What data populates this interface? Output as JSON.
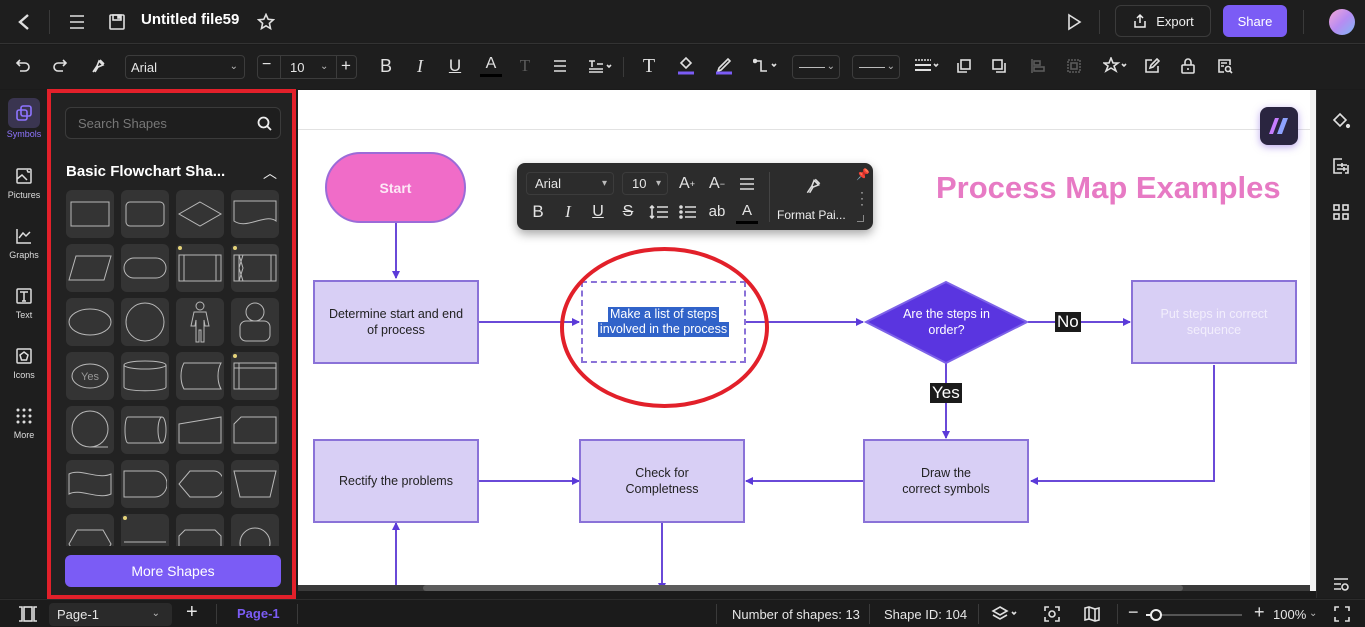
{
  "header": {
    "file_title": "Untitled file59",
    "export_label": "Export",
    "share_label": "Share",
    "icons": [
      "back-icon",
      "menu-icon",
      "save-icon",
      "star-icon",
      "play-icon",
      "export-icon",
      "avatar"
    ]
  },
  "toolbar": {
    "font_family": "Arial",
    "font_size": "10",
    "icons": [
      "undo-icon",
      "redo-icon",
      "format-painter-icon",
      "bold-icon",
      "italic-icon",
      "underline-icon",
      "font-color-icon",
      "text-style-icon",
      "align-icon",
      "text-spacing-icon",
      "text-tool-icon",
      "fill-color-icon",
      "line-color-icon",
      "connector-icon",
      "line-style-dropdown",
      "line-weight-dropdown",
      "line-dash-icon",
      "bring-front-icon",
      "send-back-icon",
      "align-shapes-icon",
      "group-icon",
      "magic-icon",
      "edit-icon",
      "lock-icon",
      "find-replace-icon"
    ]
  },
  "leftnav": {
    "items": [
      {
        "label": "Symbols",
        "active": true
      },
      {
        "label": "Pictures"
      },
      {
        "label": "Graphs"
      },
      {
        "label": "Text"
      },
      {
        "label": "Icons"
      },
      {
        "label": "More"
      }
    ]
  },
  "panel": {
    "search_placeholder": "Search Shapes",
    "section_title": "Basic Flowchart Sha...",
    "more_shapes_label": "More Shapes",
    "yes_shape_label": "Yes"
  },
  "floating_toolbar": {
    "font_family": "Arial",
    "font_size": "10",
    "format_painter_label": "Format Pai...",
    "ab_label": "ab"
  },
  "diagram": {
    "title": "Process Map Examples",
    "nodes": {
      "start": "Start",
      "determine": "Determine start and end of process",
      "make_list_line1": "Make a list of steps",
      "make_list_line2": "involved in the process",
      "decision": "Are the steps in order?",
      "put_steps": "Put steps in correct sequence",
      "rectify": "Rectify the problems",
      "check_line1": "Check for",
      "check_line2": "Completness",
      "draw_line1": "Draw the",
      "draw_line2": "correct symbols"
    },
    "labels": {
      "no": "No",
      "yes": "Yes"
    }
  },
  "statusbar": {
    "page_select": "Page-1",
    "page_tab": "Page-1",
    "shape_count": "Number of shapes: 13",
    "shape_id": "Shape ID: 104",
    "zoom": "100%",
    "zoom_fraction": 0.1
  },
  "colors": {
    "accent": "#7b5cf5",
    "title_pink": "#e77ac4",
    "node_fill": "#d8cff5",
    "decision_fill": "#5a35e0",
    "start_fill": "#f06cc8",
    "highlight_red": "#e2202a"
  }
}
